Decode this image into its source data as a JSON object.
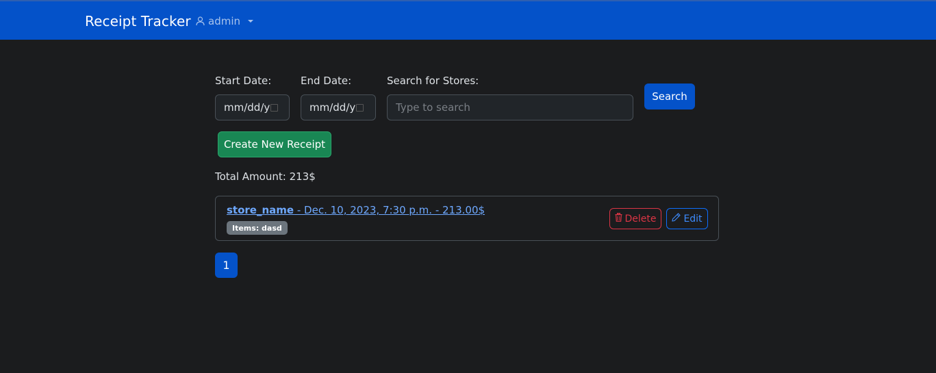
{
  "navbar": {
    "brand": "Receipt Tracker",
    "user": "admin",
    "icons": {
      "user": "user-icon",
      "caret": "chevron-down-icon"
    }
  },
  "filters": {
    "start_label": "Start Date:",
    "start_value": "mm/dd/y",
    "end_label": "End Date:",
    "end_value": "mm/dd/y",
    "store_label": "Search for Stores:",
    "store_placeholder": "Type to search",
    "search_button": "Search"
  },
  "create_button": "Create New Receipt",
  "total": "Total Amount: 213$",
  "receipts": [
    {
      "store": "store_name",
      "details": " - Dec. 10, 2023, 7:30 p.m. - 213.00$",
      "items_badge": "Items: dasd",
      "delete_label": "Delete",
      "edit_label": "Edit"
    }
  ],
  "pagination": {
    "current": "1"
  },
  "colors": {
    "navbar": "#0452c9",
    "background": "#1b1c1e",
    "primary": "#0452c9",
    "success": "#198754",
    "danger": "#dc3545",
    "link": "#6ea8fe"
  }
}
